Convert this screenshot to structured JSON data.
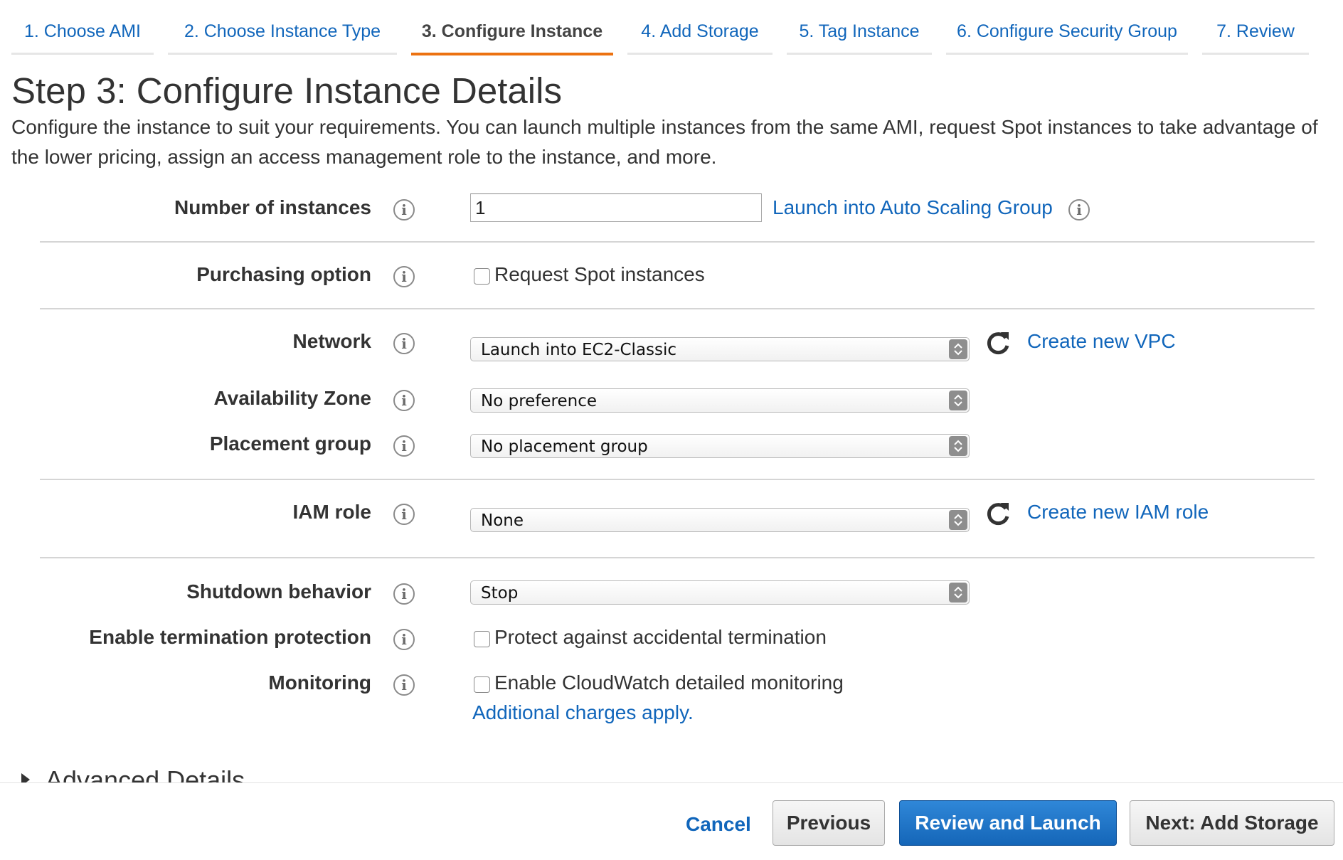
{
  "tabs": [
    {
      "label": "1. Choose AMI"
    },
    {
      "label": "2. Choose Instance Type"
    },
    {
      "label": "3. Configure Instance",
      "active": true
    },
    {
      "label": "4. Add Storage"
    },
    {
      "label": "5. Tag Instance"
    },
    {
      "label": "6. Configure Security Group"
    },
    {
      "label": "7. Review"
    }
  ],
  "page": {
    "title": "Step 3: Configure Instance Details",
    "description": "Configure the instance to suit your requirements. You can launch multiple instances from the same AMI, request Spot instances to take advantage of the lower pricing, assign an access management role to the instance, and more."
  },
  "form": {
    "number_of_instances": {
      "label": "Number of instances",
      "value": "1",
      "auto_scaling_link": "Launch into Auto Scaling Group"
    },
    "purchasing_option": {
      "label": "Purchasing option",
      "checkbox_label": "Request Spot instances",
      "checked": false
    },
    "network": {
      "label": "Network",
      "value": "Launch into EC2-Classic",
      "create_link": "Create new VPC"
    },
    "availability_zone": {
      "label": "Availability Zone",
      "value": "No preference"
    },
    "placement_group": {
      "label": "Placement group",
      "value": "No placement group"
    },
    "iam_role": {
      "label": "IAM role",
      "value": "None",
      "create_link": "Create new IAM role"
    },
    "shutdown_behavior": {
      "label": "Shutdown behavior",
      "value": "Stop"
    },
    "termination_protection": {
      "label": "Enable termination protection",
      "checkbox_label": "Protect against accidental termination",
      "checked": false
    },
    "monitoring": {
      "label": "Monitoring",
      "checkbox_label": "Enable CloudWatch detailed monitoring",
      "checked": false,
      "charges_link": "Additional charges apply."
    }
  },
  "advanced": {
    "label": "Advanced Details"
  },
  "footer": {
    "cancel": "Cancel",
    "previous": "Previous",
    "review_launch": "Review and Launch",
    "next": "Next: Add Storage"
  },
  "icons": {
    "info": "info-icon",
    "refresh": "refresh-icon",
    "select_arrows": "chevron-up-down-icon",
    "expand": "triangle-right-icon"
  },
  "colors": {
    "link": "#1166bb",
    "active_tab_underline": "#ec7211",
    "primary_button": "#1a6fc4",
    "text": "#333333"
  }
}
